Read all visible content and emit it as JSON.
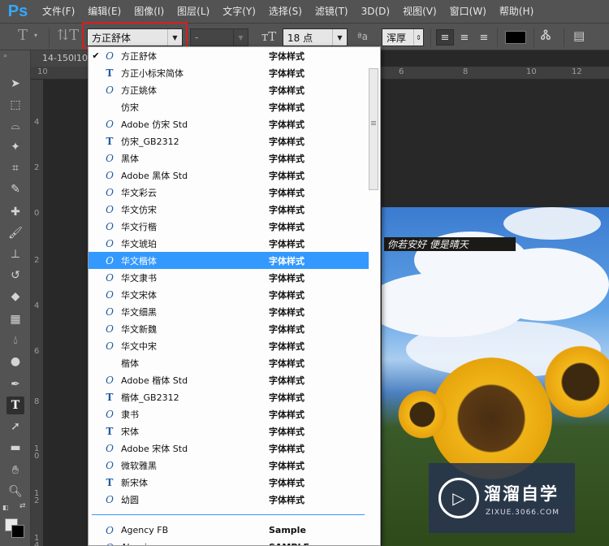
{
  "app": {
    "logo": "Ps"
  },
  "menu": [
    "文件(F)",
    "编辑(E)",
    "图像(I)",
    "图层(L)",
    "文字(Y)",
    "选择(S)",
    "滤镜(T)",
    "3D(D)",
    "视图(V)",
    "窗口(W)",
    "帮助(H)"
  ],
  "options": {
    "font_family": "方正舒体",
    "font_style": "-",
    "font_size": "18 点",
    "antialias_icon": "aa-icon",
    "antialias": "浑厚"
  },
  "document": {
    "tab_title": "14-150l10"
  },
  "ruler_top": [
    "10",
    "4",
    "6",
    "8",
    "10",
    "12"
  ],
  "ruler_left": [
    "4",
    "2",
    "0",
    "2",
    "4",
    "6",
    "8",
    "1 0",
    "1 2",
    "1 4"
  ],
  "canvas_text": "你若安好 便是晴天",
  "watermark": {
    "title": "溜溜自学",
    "url": "ZIXUE.3066.COM"
  },
  "fonts": [
    {
      "name": "方正舒体",
      "icon": "O",
      "sample": "字体样式",
      "checked": true
    },
    {
      "name": "方正小标宋简体",
      "icon": "T",
      "sample": "字体样式"
    },
    {
      "name": "方正姚体",
      "icon": "O",
      "sample": "字体样式"
    },
    {
      "name": "仿宋",
      "icon": "",
      "sample": "字体样式"
    },
    {
      "name": "Adobe 仿宋 Std",
      "icon": "O",
      "sample": "字体样式"
    },
    {
      "name": "仿宋_GB2312",
      "icon": "T",
      "sample": "字体样式"
    },
    {
      "name": "黑体",
      "icon": "O",
      "sample": "字体样式"
    },
    {
      "name": "Adobe 黑体 Std",
      "icon": "O",
      "sample": "字体样式"
    },
    {
      "name": "华文彩云",
      "icon": "O",
      "sample": "字体样式"
    },
    {
      "name": "华文仿宋",
      "icon": "O",
      "sample": "字体样式"
    },
    {
      "name": "华文行楷",
      "icon": "O",
      "sample": "字体样式"
    },
    {
      "name": "华文琥珀",
      "icon": "O",
      "sample": "字体样式"
    },
    {
      "name": "华文楷体",
      "icon": "O",
      "sample": "字体样式",
      "selected": true
    },
    {
      "name": "华文隶书",
      "icon": "O",
      "sample": "字体样式"
    },
    {
      "name": "华文宋体",
      "icon": "O",
      "sample": "字体样式"
    },
    {
      "name": "华文细黑",
      "icon": "O",
      "sample": "字体样式"
    },
    {
      "name": "华文新魏",
      "icon": "O",
      "sample": "字体样式"
    },
    {
      "name": "华文中宋",
      "icon": "O",
      "sample": "字体样式"
    },
    {
      "name": "楷体",
      "icon": "",
      "sample": "字体样式"
    },
    {
      "name": "Adobe 楷体 Std",
      "icon": "O",
      "sample": "字体样式"
    },
    {
      "name": "楷体_GB2312",
      "icon": "T",
      "sample": "字体样式"
    },
    {
      "name": "隶书",
      "icon": "O",
      "sample": "字体样式"
    },
    {
      "name": "宋体",
      "icon": "T",
      "sample": "字体样式"
    },
    {
      "name": "Adobe 宋体 Std",
      "icon": "O",
      "sample": "字体样式"
    },
    {
      "name": "微软雅黑",
      "icon": "O",
      "sample": "字体样式"
    },
    {
      "name": "新宋体",
      "icon": "T",
      "sample": "字体样式"
    },
    {
      "name": "幼圆",
      "icon": "O",
      "sample": "字体样式"
    }
  ],
  "fonts_latin": [
    {
      "name": "Agency FB",
      "icon": "O",
      "sample": "Sample"
    },
    {
      "name": "Algerian",
      "icon": "O",
      "sample": "SAMPLE"
    }
  ],
  "colors": {
    "selection": "#3399ff",
    "highlight_box": "#d81e1e",
    "ps_blue": "#31a8ff"
  }
}
